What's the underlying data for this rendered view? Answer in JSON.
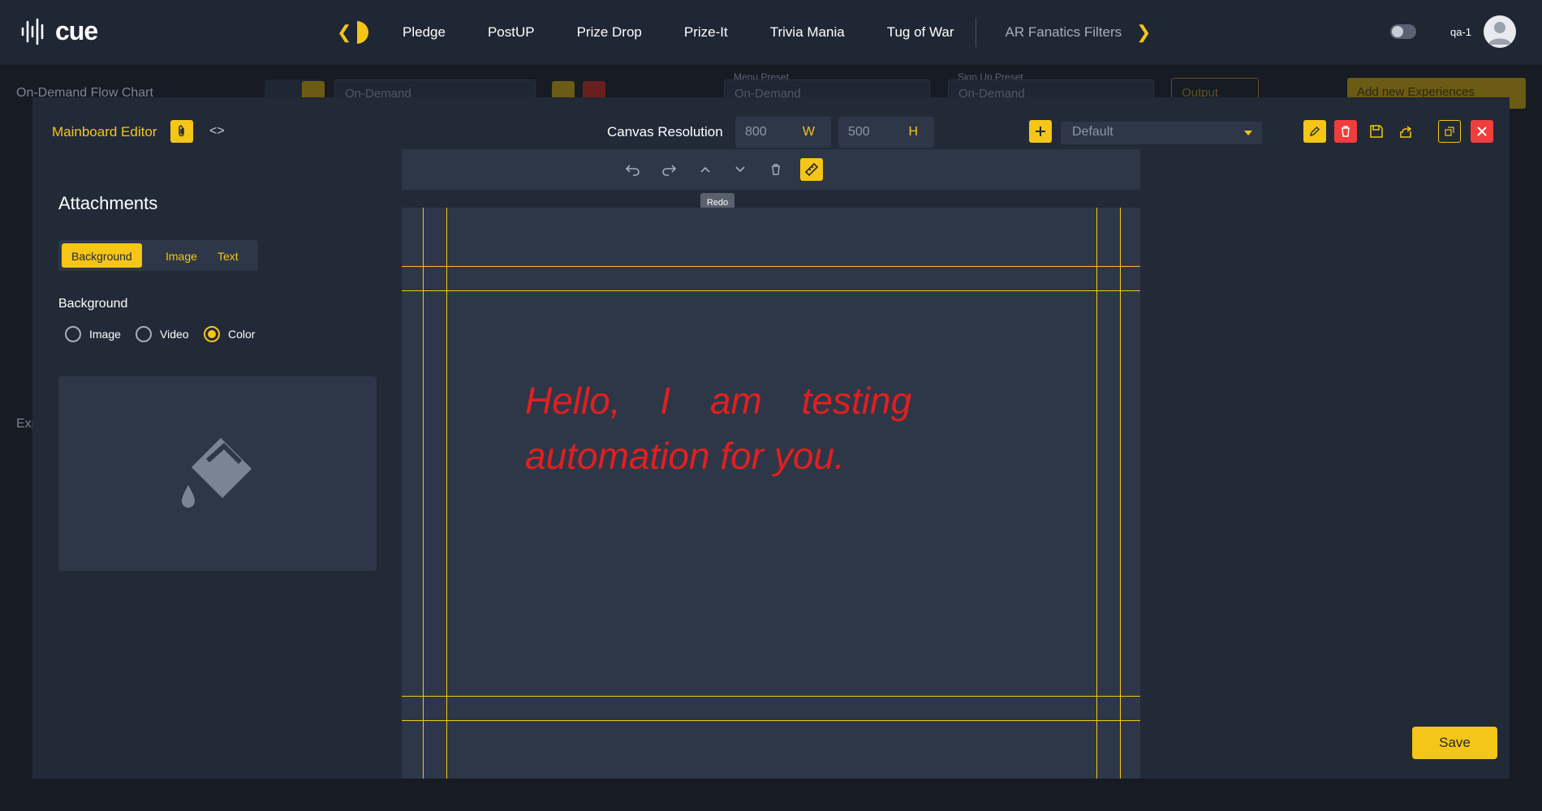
{
  "app": {
    "logo_text": "cue"
  },
  "nav": {
    "items": [
      {
        "label": "Pledge"
      },
      {
        "label": "PostUP"
      },
      {
        "label": "Prize Drop"
      },
      {
        "label": "Prize-It"
      },
      {
        "label": "Trivia Mania"
      },
      {
        "label": "Tug of War"
      },
      {
        "label": "AR Fanatics Filters"
      }
    ],
    "prev_icon": "chevron-left-icon",
    "next_icon": "chevron-right-icon"
  },
  "user": {
    "name": "qa-1",
    "avatar_icon": "user-avatar-icon",
    "theme_toggle_icon": "theme-toggle-icon"
  },
  "background_page": {
    "title": "On-Demand Flow Chart",
    "flow_select": "On-Demand",
    "menu_preset_label": "Menu Preset",
    "menu_preset_value": "On-Demand",
    "signup_preset_label": "Sign Up Preset",
    "signup_preset_value": "On-Demand",
    "output_label": "Output",
    "add_button": "Add new Experiences",
    "section_label": "Exp"
  },
  "modal": {
    "title": "Mainboard Editor",
    "resolution_label": "Canvas Resolution",
    "width_value": "800",
    "width_unit": "W",
    "height_value": "500",
    "height_unit": "H",
    "preset_value": "Default",
    "save_label": "Save"
  },
  "attachments": {
    "title": "Attachments",
    "tabs": [
      {
        "label": "Background",
        "active": true
      },
      {
        "label": "Image",
        "active": false
      },
      {
        "label": "Text",
        "active": false
      }
    ],
    "background_heading": "Background",
    "options": [
      {
        "label": "Image",
        "selected": false
      },
      {
        "label": "Video",
        "selected": false
      },
      {
        "label": "Color",
        "selected": true
      }
    ],
    "preview_icon": "paint-bucket-icon"
  },
  "canvas": {
    "tooltip": "Redo",
    "text_line1": "Hello, I am testing",
    "text_line2": "automation for you.",
    "text_color": "#e02020"
  },
  "colors": {
    "accent": "#f5c518",
    "danger": "#ef3e3e",
    "panel": "#222a38",
    "canvas": "#2e3747"
  }
}
